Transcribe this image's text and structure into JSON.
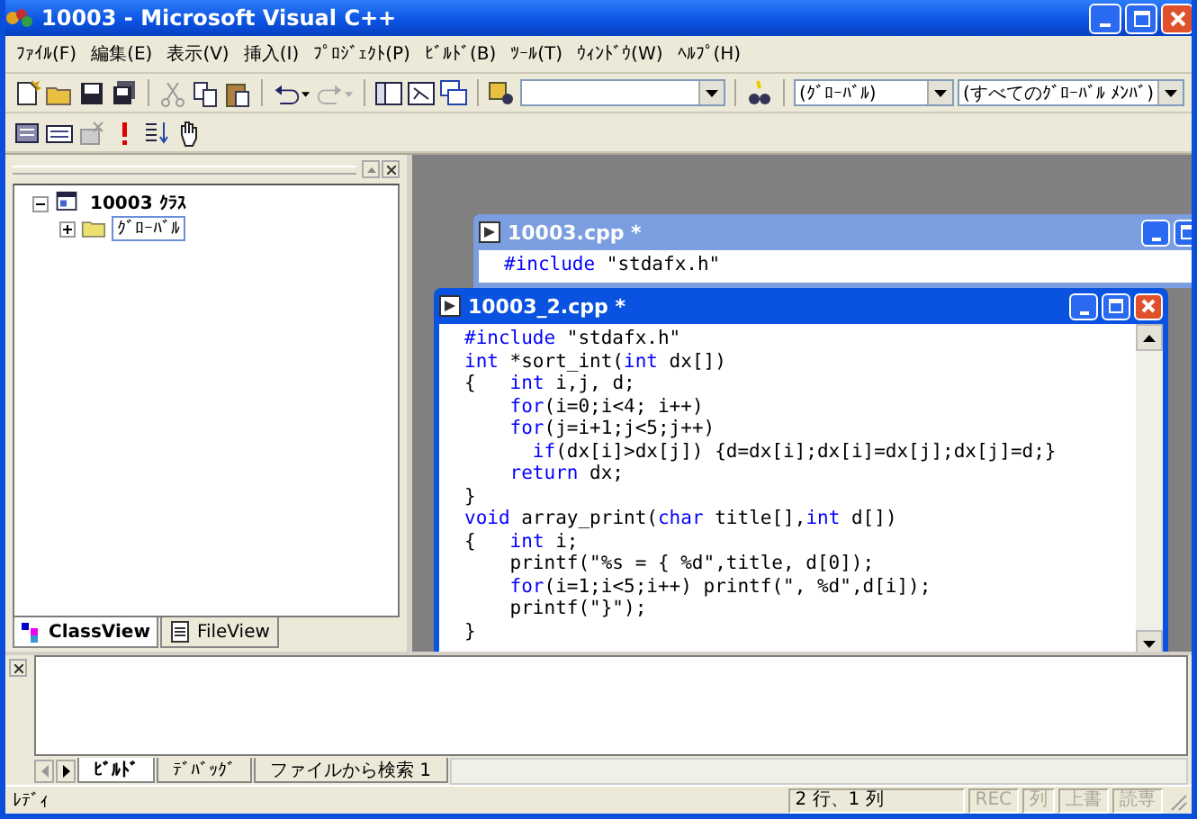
{
  "window": {
    "title": "10003 - Microsoft Visual C++"
  },
  "menu": [
    "ﾌｧｲﾙ(F)",
    "編集(E)",
    "表示(V)",
    "挿入(I)",
    "ﾌﾟﾛｼﾞｪｸﾄ(P)",
    "ﾋﾞﾙﾄﾞ(B)",
    "ﾂｰﾙ(T)",
    "ｳｨﾝﾄﾞｳ(W)",
    "ﾍﾙﾌﾟ(H)"
  ],
  "toolbar": {
    "class_combo": "(ｸﾞﾛｰﾊﾞﾙ)",
    "member_combo": "(すべてのｸﾞﾛｰﾊﾞﾙ ﾒﾝﾊﾞ)"
  },
  "workspace": {
    "tree": [
      {
        "label": "10003 ｸﾗｽ",
        "expanded": true,
        "children": [
          {
            "label": "ｸﾞﾛｰﾊﾞﾙ",
            "expanded": false,
            "selected": true
          }
        ]
      }
    ],
    "tabs": [
      {
        "label": "ClassView",
        "selected": true
      },
      {
        "label": "FileView",
        "selected": false
      }
    ]
  },
  "editors": [
    {
      "title": "10003.cpp *",
      "lines": [
        [
          {
            "text": "#include",
            "kind": "keyword"
          },
          {
            "text": " \"stdafx.h\"",
            "kind": "plain"
          }
        ]
      ]
    },
    {
      "title": "10003_2.cpp *",
      "lines": [
        [
          {
            "text": "#include",
            "kind": "keyword"
          },
          {
            "text": " \"stdafx.h\"",
            "kind": "plain"
          }
        ],
        [
          {
            "text": "int",
            "kind": "keyword"
          },
          {
            "text": " *sort_int(",
            "kind": "plain"
          },
          {
            "text": "int",
            "kind": "keyword"
          },
          {
            "text": " dx[])",
            "kind": "plain"
          }
        ],
        [
          {
            "text": "{   ",
            "kind": "plain"
          },
          {
            "text": "int",
            "kind": "keyword"
          },
          {
            "text": " i,j, d;",
            "kind": "plain"
          }
        ],
        [
          {
            "text": "    for",
            "kind": "keyword"
          },
          {
            "text": "(i=0;i<4; i++)",
            "kind": "plain"
          }
        ],
        [
          {
            "text": "    for",
            "kind": "keyword"
          },
          {
            "text": "(j=i+1;j<5;j++)",
            "kind": "plain"
          }
        ],
        [
          {
            "text": "      if",
            "kind": "keyword"
          },
          {
            "text": "(dx[i]>dx[j]) {d=dx[i];dx[i]=dx[j];dx[j]=d;}",
            "kind": "plain"
          }
        ],
        [
          {
            "text": "    return",
            "kind": "keyword"
          },
          {
            "text": " dx;",
            "kind": "plain"
          }
        ],
        [
          {
            "text": "}",
            "kind": "plain"
          }
        ],
        [
          {
            "text": "void",
            "kind": "keyword"
          },
          {
            "text": " array_print(",
            "kind": "plain"
          },
          {
            "text": "char",
            "kind": "keyword"
          },
          {
            "text": " title[],",
            "kind": "plain"
          },
          {
            "text": "int",
            "kind": "keyword"
          },
          {
            "text": " d[])",
            "kind": "plain"
          }
        ],
        [
          {
            "text": "{   ",
            "kind": "plain"
          },
          {
            "text": "int",
            "kind": "keyword"
          },
          {
            "text": " i;",
            "kind": "plain"
          }
        ],
        [
          {
            "text": "    printf(\"%s = { %d\",title, d[0]);",
            "kind": "plain"
          }
        ],
        [
          {
            "text": "    for",
            "kind": "keyword"
          },
          {
            "text": "(i=1;i<5;i++) printf(\", %d\",d[i]);",
            "kind": "plain"
          }
        ],
        [
          {
            "text": "    printf(\"}\");",
            "kind": "plain"
          }
        ],
        [
          {
            "text": "}",
            "kind": "plain"
          }
        ]
      ]
    }
  ],
  "output": {
    "tabs": [
      {
        "label": "ﾋﾞﾙﾄﾞ",
        "selected": true
      },
      {
        "label": "ﾃﾞﾊﾞｯｸﾞ",
        "selected": false
      },
      {
        "label": "ファイルから検索 1",
        "selected": false
      }
    ]
  },
  "status_bar": {
    "message": "ﾚﾃﾞｨ",
    "position": "2 行、1 列",
    "indicators": [
      {
        "label": "REC",
        "on": false
      },
      {
        "label": "列",
        "on": false
      },
      {
        "label": "上書",
        "on": false
      },
      {
        "label": "読専",
        "on": false
      }
    ]
  }
}
